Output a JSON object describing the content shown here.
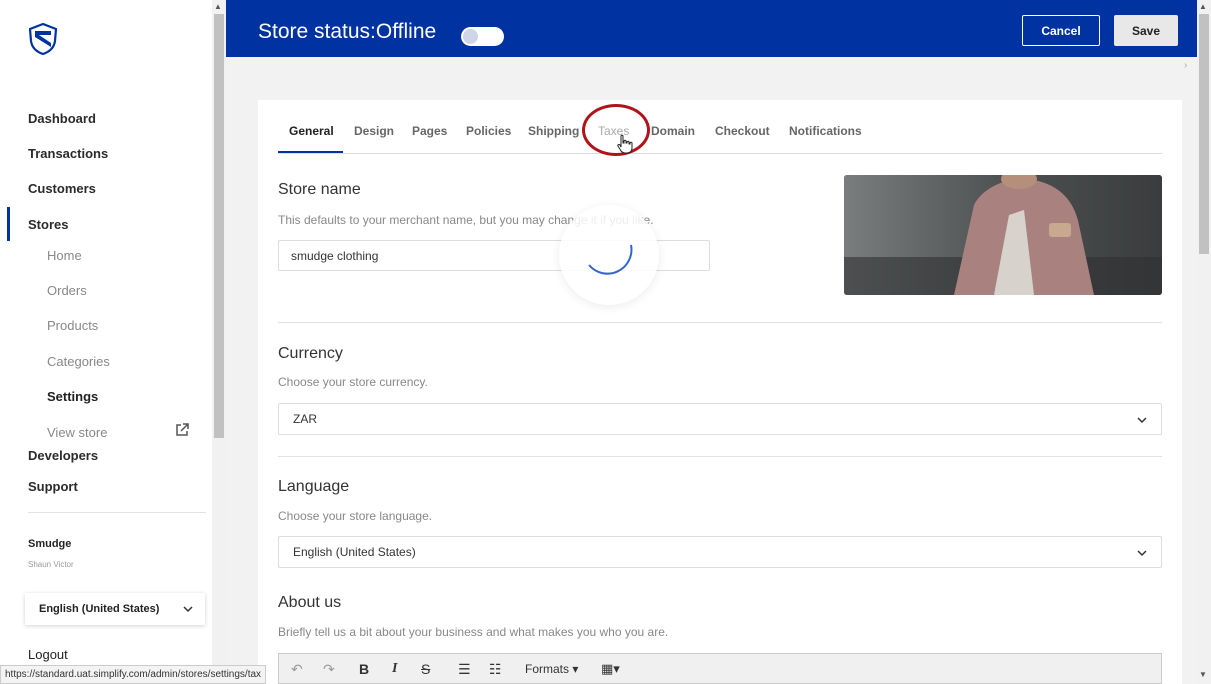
{
  "sidebar": {
    "nav": [
      {
        "label": "Dashboard"
      },
      {
        "label": "Transactions"
      },
      {
        "label": "Customers"
      },
      {
        "label": "Stores"
      }
    ],
    "stores_sub": [
      {
        "label": "Home"
      },
      {
        "label": "Orders"
      },
      {
        "label": "Products"
      },
      {
        "label": "Categories"
      },
      {
        "label": "Settings"
      },
      {
        "label": "View store"
      }
    ],
    "nav_after": [
      {
        "label": "Developers"
      },
      {
        "label": "Support"
      }
    ],
    "merchant": {
      "name": "Smudge",
      "user": "Shaun Victor"
    },
    "language": "English (United States)",
    "logout": "Logout"
  },
  "header": {
    "store_status": "Store status:Offline",
    "cancel_label": "Cancel",
    "save_label": "Save"
  },
  "tabs": [
    {
      "label": "General"
    },
    {
      "label": "Design"
    },
    {
      "label": "Pages"
    },
    {
      "label": "Policies"
    },
    {
      "label": "Shipping"
    },
    {
      "label": "Taxes"
    },
    {
      "label": "Domain"
    },
    {
      "label": "Checkout"
    },
    {
      "label": "Notifications"
    }
  ],
  "general": {
    "store_name": {
      "title": "Store name",
      "desc": "This defaults to your merchant name, but you may change it if you like.",
      "value": "smudge clothing"
    },
    "currency": {
      "title": "Currency",
      "desc": "Choose your store currency.",
      "value": "ZAR"
    },
    "language": {
      "title": "Language",
      "desc": "Choose your store language.",
      "value": "English (United States)"
    },
    "about": {
      "title": "About us",
      "desc": "Briefly tell us a bit about your business and what makes you who you are."
    }
  },
  "editor": {
    "formats_label": "Formats"
  },
  "status_url": "https://standard.uat.simplify.com/admin/stores/settings/tax",
  "colors": {
    "brand": "#0033a1",
    "highlight": "#b0141a"
  }
}
